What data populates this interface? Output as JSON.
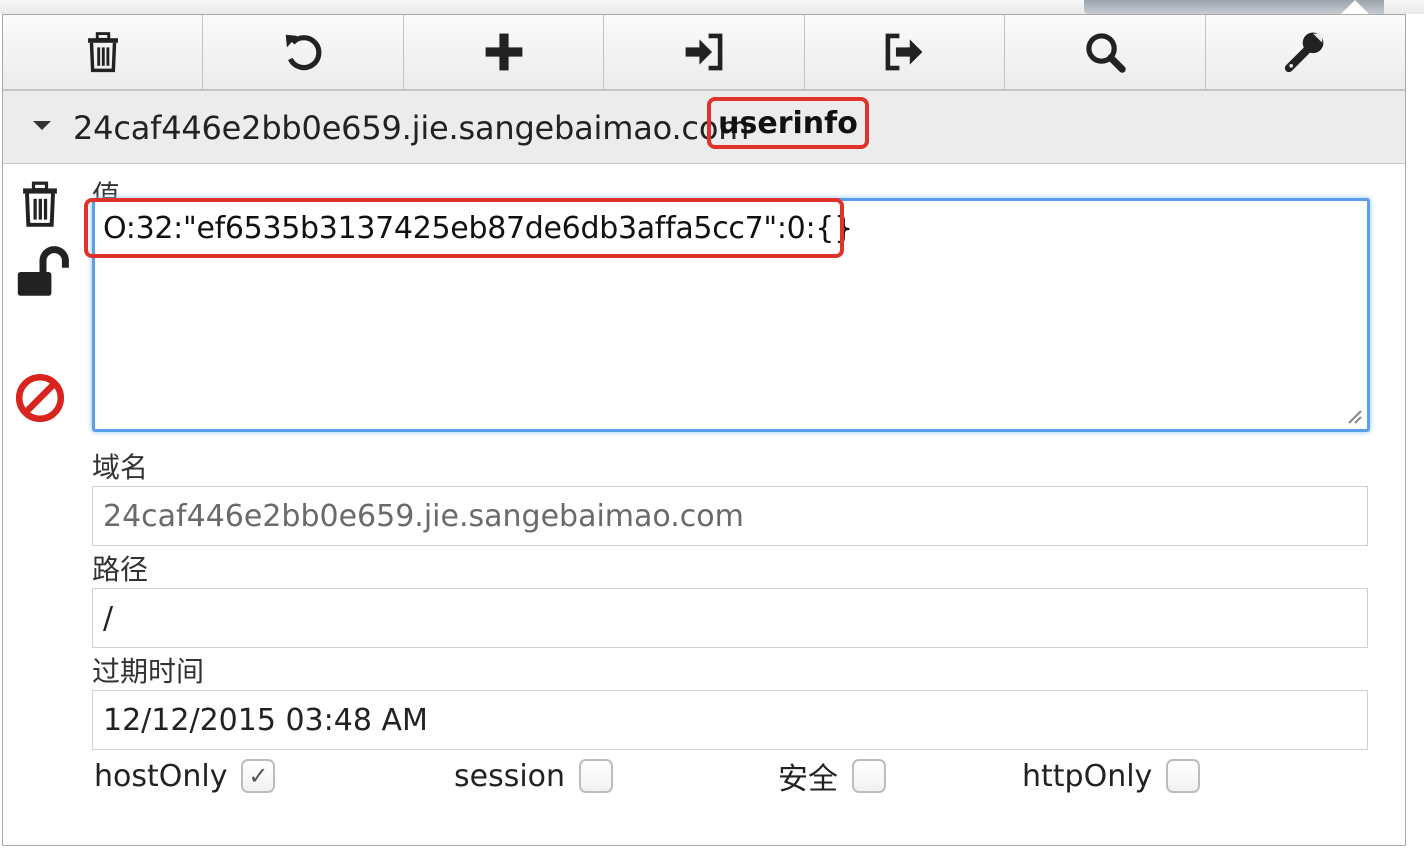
{
  "toolbar": {
    "buttons": [
      {
        "icon": "trash-icon"
      },
      {
        "icon": "undo-icon"
      },
      {
        "icon": "plus-icon"
      },
      {
        "icon": "import-icon"
      },
      {
        "icon": "export-icon"
      },
      {
        "icon": "search-icon"
      },
      {
        "icon": "wrench-icon"
      }
    ]
  },
  "cookie": {
    "domain_header": "24caf446e2bb0e659.jie.sangebaimao.com",
    "name": "userinfo",
    "value_label": "值",
    "value": "O:32:\"ef6535b3137425eb87de6db3affa5cc7\":0:{}",
    "domain_label": "域名",
    "domain": "24caf446e2bb0e659.jie.sangebaimao.com",
    "path_label": "路径",
    "path": "/",
    "expires_label": "过期时间",
    "expires": "12/12/2015 03:48 AM"
  },
  "options": {
    "hostonly_label": "hostOnly",
    "hostonly_checked": true,
    "hostonly_mark": "✓",
    "session_label": "session",
    "session_checked": false,
    "secure_label": "安全",
    "secure_checked": false,
    "httponly_label": "httpOnly",
    "httponly_checked": false
  },
  "colors": {
    "highlight": "#e0312a",
    "focus": "#5b9ee9",
    "block_icon": "#d9231d"
  }
}
